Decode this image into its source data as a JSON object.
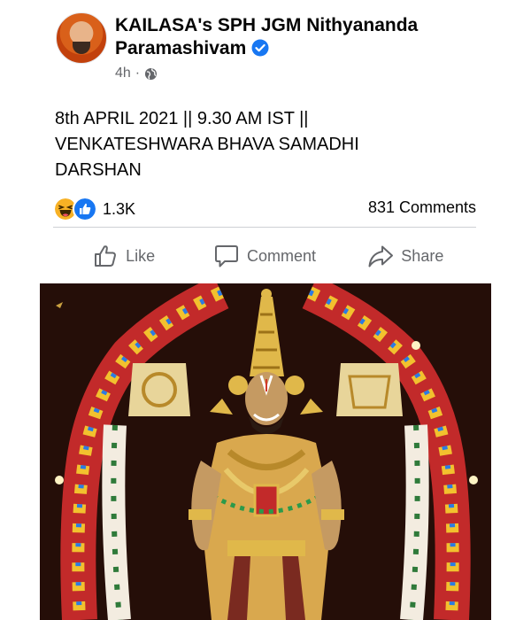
{
  "post": {
    "author": "KAILASA's SPH JGM Nithyananda Paramashivam",
    "time": "4h",
    "separator": "·",
    "text_lines": [
      "8th APRIL 2021 || 9.30 AM IST ||",
      "VENKATESHWARA BHAVA SAMADHI",
      "DARSHAN"
    ]
  },
  "stats": {
    "reactions_count": "1.3K",
    "comments_count": "831 Comments"
  },
  "actions": {
    "like": "Like",
    "comment": "Comment",
    "share": "Share"
  },
  "icons": {
    "verified": "verified-badge-icon",
    "audience": "globe-icon",
    "reaction_1": "haha-reaction-icon",
    "reaction_2": "like-reaction-icon",
    "like": "thumbs-up-icon",
    "comment": "speech-bubble-icon",
    "share": "share-arrow-icon"
  },
  "colors": {
    "verified_blue": "#1877f2",
    "muted_text": "#65676b",
    "divider": "#ced0d4"
  }
}
